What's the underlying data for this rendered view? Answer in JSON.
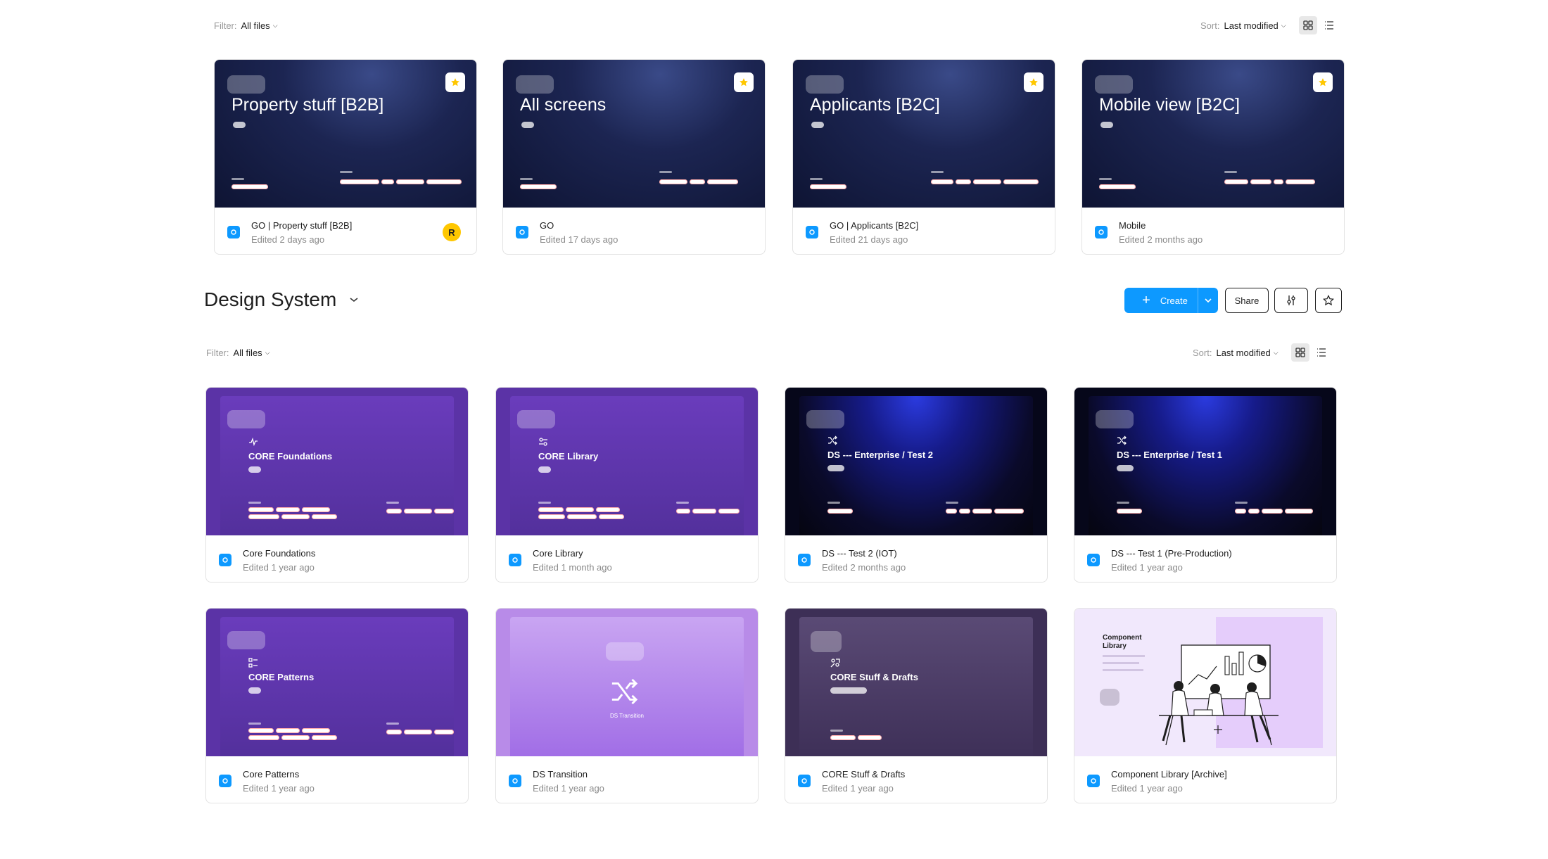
{
  "top_section": {
    "filter": {
      "label": "Filter:",
      "value": "All files"
    },
    "sort": {
      "label": "Sort:",
      "value": "Last modified"
    },
    "files": [
      {
        "thumb_title": "Property stuff [B2B]",
        "name": "GO | Property stuff [B2B]",
        "edited": "Edited 2 days ago",
        "avatar": "R",
        "starred": true
      },
      {
        "thumb_title": "All screens",
        "name": "GO",
        "edited": "Edited 17 days ago",
        "starred": true
      },
      {
        "thumb_title": "Applicants [B2C]",
        "name": "GO | Applicants [B2C]",
        "edited": "Edited 21 days ago",
        "starred": true
      },
      {
        "thumb_title": "Mobile view [B2C]",
        "name": "Mobile",
        "edited": "Edited 2 months ago",
        "starred": true
      }
    ]
  },
  "design_system": {
    "title": "Design System",
    "buttons": {
      "create": "Create",
      "share": "Share"
    },
    "filter": {
      "label": "Filter:",
      "value": "All files"
    },
    "sort": {
      "label": "Sort:",
      "value": "Last modified"
    },
    "files": [
      {
        "thumb_title": "CORE Foundations",
        "name": "Core Foundations",
        "edited": "Edited 1 year ago",
        "icon": "pulse-icon"
      },
      {
        "thumb_title": "CORE Library",
        "name": "Core Library",
        "edited": "Edited 1 month ago",
        "icon": "components-icon"
      },
      {
        "thumb_title": "DS --- Enterprise / Test 2",
        "name": "DS --- Test 2 (IOT)",
        "edited": "Edited 2 months ago",
        "icon": "shuffle-icon"
      },
      {
        "thumb_title": "DS --- Enterprise / Test 1",
        "name": "DS --- Test 1 (Pre-Production)",
        "edited": "Edited 1 year ago",
        "icon": "shuffle-icon"
      },
      {
        "thumb_title": "CORE Patterns",
        "name": "Core Patterns",
        "edited": "Edited 1 year ago",
        "icon": "patterns-icon"
      },
      {
        "thumb_title": "DS Transition",
        "name": "DS Transition",
        "edited": "Edited 1 year ago",
        "icon": "shuffle-icon"
      },
      {
        "thumb_title": "CORE Stuff & Drafts",
        "name": "CORE Stuff & Drafts",
        "edited": "Edited 1 year ago",
        "icon": "drafts-icon"
      },
      {
        "thumb_title": "Component Library",
        "name": "Component Library [Archive]",
        "edited": "Edited 1 year ago",
        "icon": "illustration"
      }
    ]
  },
  "colors": {
    "accent": "#0d99ff",
    "star": "#ffc700",
    "purple": "#5b33a6",
    "navy": "#111838"
  }
}
